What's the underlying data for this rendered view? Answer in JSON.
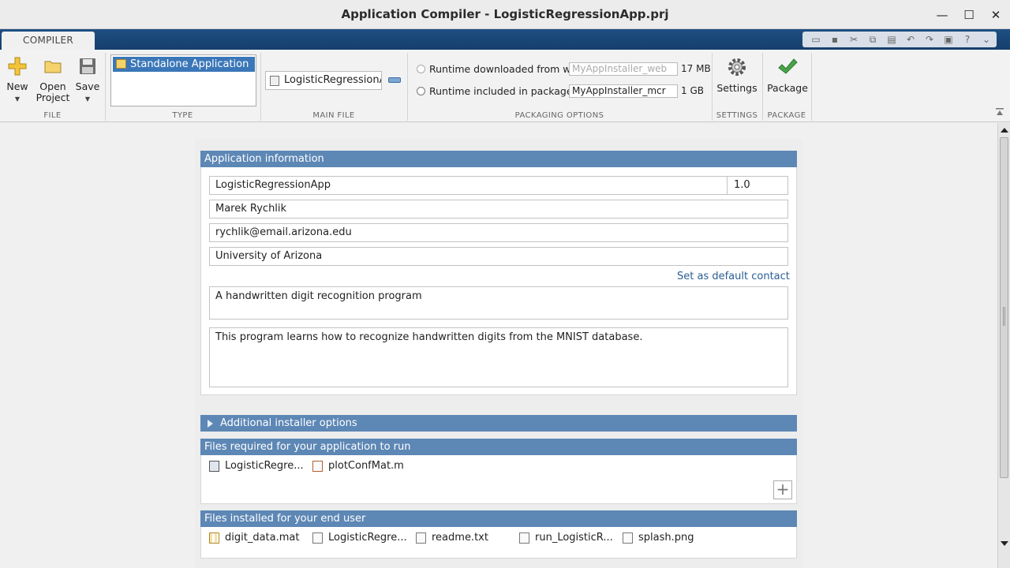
{
  "window": {
    "title": "Application Compiler - LogisticRegressionApp.prj",
    "minimize": "—",
    "maximize": "☐",
    "close": "✕"
  },
  "tabs": {
    "compiler": "COMPILER"
  },
  "ribbon": {
    "file": {
      "new_label": "New",
      "open_label_1": "Open",
      "open_label_2": "Project",
      "save_label": "Save",
      "group_label": "FILE"
    },
    "type": {
      "selected": "Standalone Application",
      "group_label": "TYPE"
    },
    "main_file": {
      "value": "LogisticRegressionApp",
      "group_label": "MAIN FILE"
    },
    "packaging": {
      "web_label": "Runtime downloaded from web",
      "web_installer_name": "MyAppInstaller_web",
      "web_size": "17 MB",
      "included_label": "Runtime included in package",
      "included_installer_name": "MyAppInstaller_mcr",
      "included_size": "1 GB",
      "group_label": "PACKAGING OPTIONS"
    },
    "settings": {
      "label": "Settings",
      "group_label": "SETTINGS"
    },
    "package": {
      "label": "Package",
      "group_label": "PACKAGE"
    }
  },
  "app_info": {
    "header": "Application information",
    "name": "LogisticRegressionApp",
    "version": "1.0",
    "author": "Marek Rychlik",
    "email": "rychlik@email.arizona.edu",
    "company": "University of Arizona",
    "default_contact_link": "Set as default contact",
    "summary": "A handwritten digit recognition program",
    "description": "This program learns how to recognize handwritten digits from the MNIST database."
  },
  "additional_options": {
    "header": "Additional installer options"
  },
  "files_required": {
    "header": "Files required for your application to run",
    "items": [
      "LogisticRegre...",
      "plotConfMat.m"
    ]
  },
  "files_installed": {
    "header": "Files installed for your end user",
    "items": [
      "digit_data.mat",
      "LogisticRegre...",
      "readme.txt",
      "run_LogisticR...",
      "splash.png"
    ]
  },
  "colors": {
    "section_header": "#5d87b5",
    "link": "#2a5d94",
    "ribbon_tab": "#1f4f83",
    "selection": "#3b77b8"
  }
}
